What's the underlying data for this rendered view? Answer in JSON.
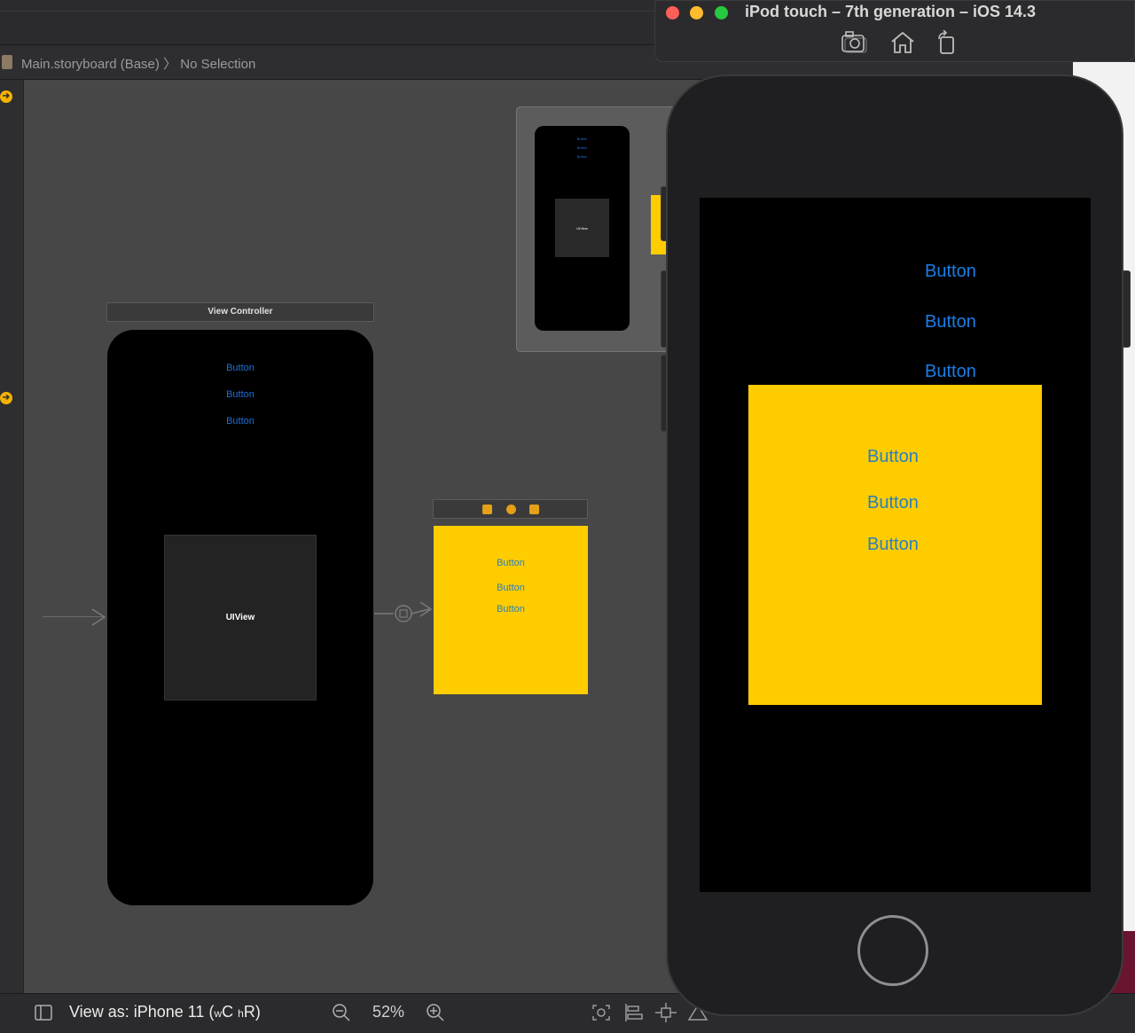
{
  "jumpbar": {
    "file": "Main.storyboard (Base)",
    "separator": "〉",
    "selection": "No Selection"
  },
  "storyboard": {
    "view_controller_title": "View Controller",
    "buttons": [
      "Button",
      "Button",
      "Button"
    ],
    "uiview_label": "UIView",
    "yellow_buttons": [
      "Button",
      "Button",
      "Button"
    ]
  },
  "thumbnail": {
    "uiview_label": "UIView",
    "buttons": [
      "Button",
      "Button",
      "Button"
    ]
  },
  "bottombar": {
    "view_as_prefix": "View as: iPhone 11 (",
    "w_small": "w",
    "w_big": "C",
    "h_small": "h",
    "h_big": "R",
    "suffix": ")",
    "zoom": "52%"
  },
  "simulator": {
    "title": "iPod touch – 7th generation – iOS 14.3",
    "top_buttons": [
      "Button",
      "Button",
      "Button"
    ],
    "yellow_buttons": [
      "Button",
      "Button",
      "Button"
    ]
  },
  "colors": {
    "accent_blue": "#1a7ee6",
    "yellow": "#ffcc00",
    "close": "#ff5f57",
    "minimize": "#febc2e",
    "zoom": "#28c840"
  },
  "icons": [
    "screenshot-icon",
    "home-icon",
    "rotate-icon",
    "zoom-out-icon",
    "zoom-in-icon",
    "sidebar-toggle-icon"
  ]
}
